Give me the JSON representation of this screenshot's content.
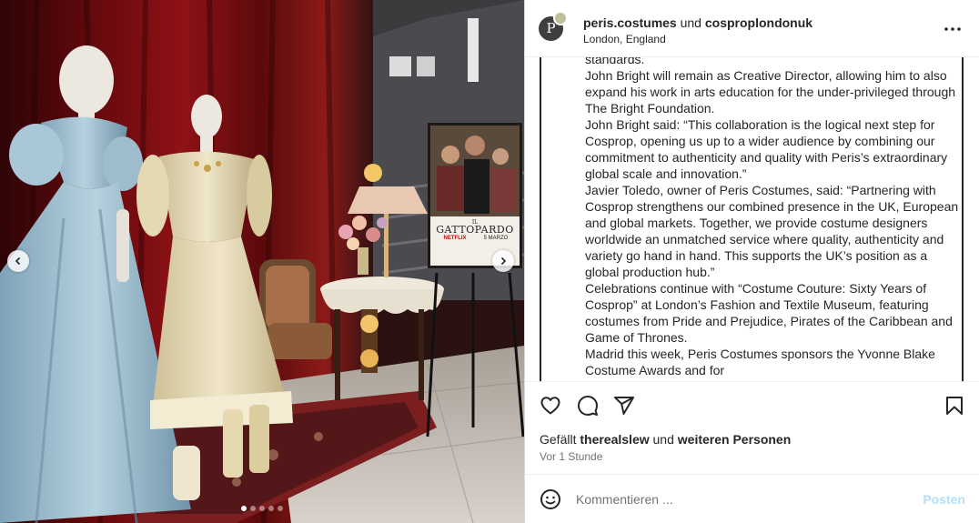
{
  "post": {
    "author": "peris.costumes",
    "connector": "und",
    "coauthor": "cosproplondonuk",
    "location": "London, England",
    "avatar_letter": "P"
  },
  "caption": {
    "lines": [
      "standards.",
      "John Bright will remain as Creative Director, allowing him to also expand his work in arts education for the under-privileged through The Bright Foundation.",
      "John Bright said: “This collaboration is the logical next step for Cosprop, opening us up to a wider audience by combining our commitment to authenticity and quality with Peris’s extraordinary global scale and innovation.”",
      "Javier Toledo, owner of Peris Costumes, said: “Partnering with Cosprop strengthens our combined presence in the UK, European and global markets. Together, we provide costume designers worldwide an unmatched service where quality, authenticity and variety go hand in hand. This supports the UK’s position as a global production hub.”",
      "Celebrations continue with “Costume Couture: Sixty Years of Cosprop” at London’s Fashion and Textile Museum, featuring costumes from Pride and Prejudice, Pirates of the Caribbean and Game of Thrones.",
      "Madrid this week, Peris Costumes sponsors the Yvonne Blake Costume Awards and for"
    ]
  },
  "poster": {
    "title": "GATTOPARDO",
    "prefix": "IL",
    "network": "NETFLIX",
    "date": "5 MARZO"
  },
  "engagement": {
    "liked_prefix": "Gefällt",
    "liked_user": "therealslew",
    "liked_connector": "und",
    "liked_others": "weiteren Personen",
    "time_ago": "Vor 1 Stunde"
  },
  "comment": {
    "placeholder": "Kommentieren ...",
    "post_label": "Posten"
  },
  "carousel": {
    "total_slides": 5,
    "active_slide": 1
  },
  "icons": {
    "more": "more-horizontal-icon",
    "like": "heart-icon",
    "comment": "comment-icon",
    "share": "share-icon",
    "save": "bookmark-icon",
    "emoji": "emoji-icon",
    "prev": "chevron-left-icon",
    "next": "chevron-right-icon"
  },
  "colors": {
    "link_disabled": "#b2dffc",
    "text": "#262626",
    "muted": "#737373"
  }
}
